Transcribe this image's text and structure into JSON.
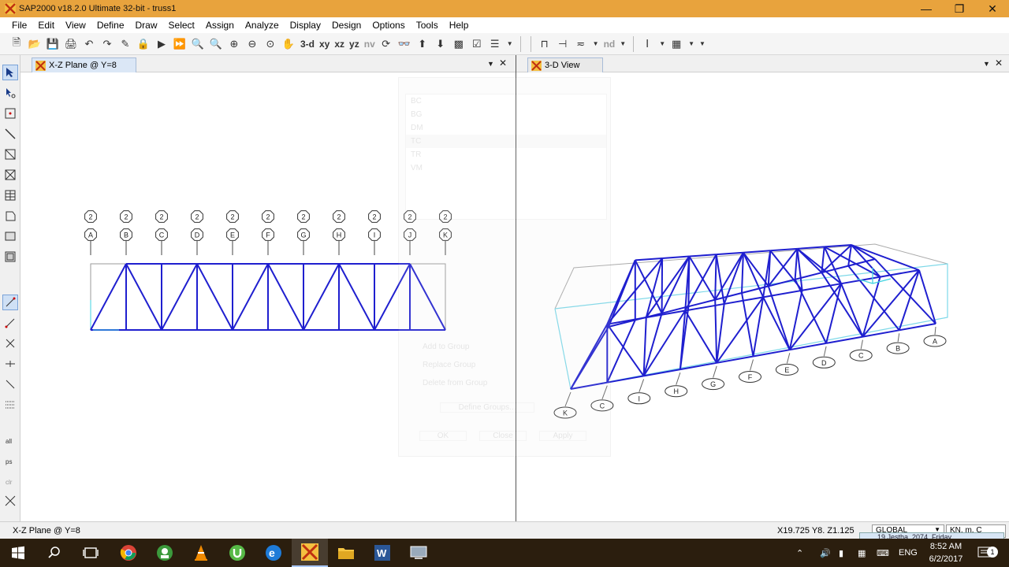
{
  "window": {
    "title": "SAP2000 v18.2.0 Ultimate 32-bit - truss1",
    "minimize_icon": "minimize-icon",
    "restore_icon": "restore-icon",
    "close_icon": "close-icon"
  },
  "menu": [
    "File",
    "Edit",
    "View",
    "Define",
    "Draw",
    "Select",
    "Assign",
    "Analyze",
    "Display",
    "Design",
    "Options",
    "Tools",
    "Help"
  ],
  "toolbar": {
    "view_3d": "3-d",
    "view_xy": "xy",
    "view_xz": "xz",
    "view_yz": "yz",
    "view_nv": "nv",
    "nd": "nd"
  },
  "left_pane": {
    "tab_title": "X-Z Plane @ Y=8",
    "grid_top_labels": [
      "2",
      "2",
      "2",
      "2",
      "2",
      "2",
      "2",
      "2",
      "2",
      "2",
      "2"
    ],
    "grid_bottom_labels": [
      "A",
      "B",
      "C",
      "D",
      "E",
      "F",
      "G",
      "H",
      "I",
      "J",
      "K"
    ],
    "truss_color": "#1f1fcf"
  },
  "right_pane": {
    "tab_title": "3-D View",
    "grid_labels": [
      "K",
      "C",
      "I",
      "H",
      "G",
      "F",
      "E",
      "D",
      "C",
      "B",
      "A"
    ],
    "truss_color": "#1f1fcf",
    "box_color": "#7dd8e8"
  },
  "ghost_dialog": {
    "groups": [
      "BC",
      "BG",
      "DM",
      "TC",
      "TR",
      "VM"
    ],
    "options": [
      "Add to Group",
      "Replace Group",
      "Delete from Group"
    ],
    "define_button": "Define Groups...",
    "ok": "OK",
    "close": "Close",
    "apply": "Apply"
  },
  "status": {
    "view_name": "X-Z Plane @ Y=8",
    "coords": "X19.725  Y8.  Z1.125",
    "coord_system": "GLOBAL",
    "units": "KN, m, C"
  },
  "taskbar": {
    "notification": "19 Jestha, 2074, Friday",
    "language": "ENG",
    "time": "8:52 AM",
    "date": "6/2/2017",
    "notification_count": "1"
  }
}
